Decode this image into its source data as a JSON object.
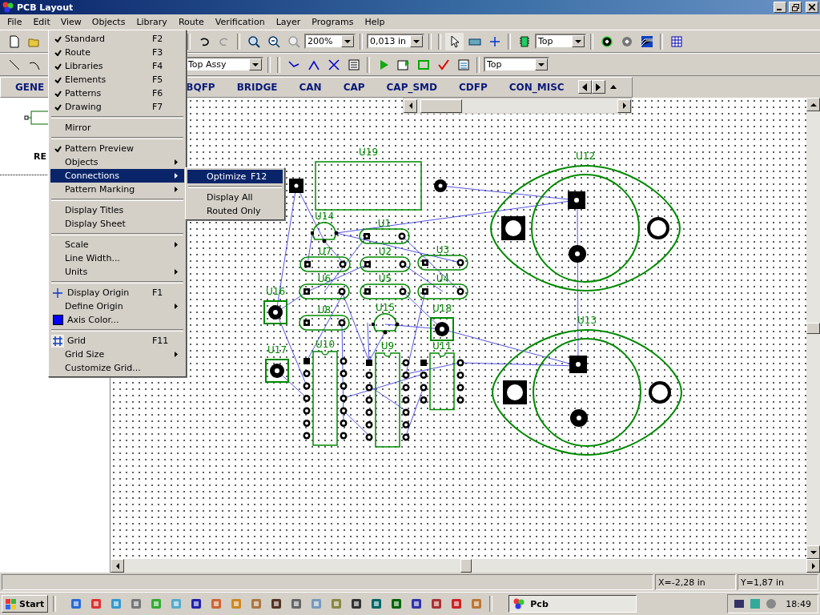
{
  "window": {
    "title": "PCB Layout"
  },
  "menu_bar": [
    {
      "label": "File",
      "selected": false
    },
    {
      "label": "Edit",
      "selected": false
    },
    {
      "label": "View",
      "selected": true
    },
    {
      "label": "Objects",
      "selected": false
    },
    {
      "label": "Library",
      "selected": false
    },
    {
      "label": "Route",
      "selected": false
    },
    {
      "label": "Verification",
      "selected": false
    },
    {
      "label": "Layer",
      "selected": false
    },
    {
      "label": "Programs",
      "selected": false
    },
    {
      "label": "Help",
      "selected": false
    }
  ],
  "toolbar_1": {
    "zoom": "200%",
    "line_width": "0,013 in",
    "layer": "Top"
  },
  "toolbar_2": {
    "assembly_layer": "Top Assy",
    "layer": "Top"
  },
  "library_tabs": [
    "GENE",
    "BQFP",
    "BRIDGE",
    "CAN",
    "CAP",
    "CAP_SMD",
    "CDFP",
    "CON_MISC"
  ],
  "pattern_preview": {
    "label": "RE"
  },
  "view_menu": [
    {
      "kind": "item",
      "label": "Standard",
      "shortcut": "F2",
      "checked": true,
      "selected": false,
      "submenu": false
    },
    {
      "kind": "item",
      "label": "Route",
      "shortcut": "F3",
      "checked": true,
      "selected": false,
      "submenu": false
    },
    {
      "kind": "item",
      "label": "Libraries",
      "shortcut": "F4",
      "checked": true,
      "selected": false,
      "submenu": false
    },
    {
      "kind": "item",
      "label": "Elements",
      "shortcut": "F5",
      "checked": true,
      "selected": false,
      "submenu": false
    },
    {
      "kind": "item",
      "label": "Patterns",
      "shortcut": "F6",
      "checked": true,
      "selected": false,
      "submenu": false
    },
    {
      "kind": "item",
      "label": "Drawing",
      "shortcut": "F7",
      "checked": true,
      "selected": false,
      "submenu": false
    },
    {
      "kind": "separator"
    },
    {
      "kind": "item",
      "label": "Mirror",
      "checked": false,
      "selected": false,
      "submenu": false
    },
    {
      "kind": "separator"
    },
    {
      "kind": "item",
      "label": "Pattern Preview",
      "checked": true,
      "selected": false,
      "submenu": false
    },
    {
      "kind": "item",
      "label": "Objects",
      "checked": false,
      "selected": false,
      "submenu": true
    },
    {
      "kind": "item",
      "label": "Connections",
      "checked": false,
      "selected": true,
      "submenu": true
    },
    {
      "kind": "item",
      "label": "Pattern Marking",
      "checked": false,
      "selected": false,
      "submenu": true
    },
    {
      "kind": "separator"
    },
    {
      "kind": "item",
      "label": "Display Titles",
      "checked": false,
      "selected": false,
      "submenu": false
    },
    {
      "kind": "item",
      "label": "Display Sheet",
      "checked": false,
      "selected": false,
      "submenu": false
    },
    {
      "kind": "separator"
    },
    {
      "kind": "item",
      "label": "Scale",
      "checked": false,
      "selected": false,
      "submenu": true
    },
    {
      "kind": "item",
      "label": "Line Width...",
      "checked": false,
      "selected": false,
      "submenu": false
    },
    {
      "kind": "item",
      "label": "Units",
      "checked": false,
      "selected": false,
      "submenu": true
    },
    {
      "kind": "separator"
    },
    {
      "kind": "item",
      "label": "Display Origin",
      "shortcut": "F1",
      "checked": false,
      "selected": false,
      "submenu": false
    },
    {
      "kind": "item",
      "label": "Define Origin",
      "checked": false,
      "selected": false,
      "submenu": true
    },
    {
      "kind": "item",
      "label": "Axis Color...",
      "checked": false,
      "selected": false,
      "submenu": false
    },
    {
      "kind": "separator"
    },
    {
      "kind": "item",
      "label": "Grid",
      "shortcut": "F11",
      "checked": true,
      "selected": false,
      "submenu": false
    },
    {
      "kind": "item",
      "label": "Grid Size",
      "checked": false,
      "selected": false,
      "submenu": true
    },
    {
      "kind": "item",
      "label": "Customize Grid...",
      "checked": false,
      "selected": false,
      "submenu": false
    }
  ],
  "connections_submenu": [
    {
      "kind": "item",
      "label": "Optimize",
      "shortcut": "F12",
      "selected": true
    },
    {
      "kind": "separator"
    },
    {
      "kind": "item",
      "label": "Display All",
      "selected": false
    },
    {
      "kind": "item",
      "label": "Routed Only",
      "selected": false
    }
  ],
  "board": {
    "components": [
      {
        "ref": "U19",
        "kind": "box"
      },
      {
        "ref": "U12",
        "kind": "to3"
      },
      {
        "ref": "U14",
        "kind": "to92"
      },
      {
        "ref": "U1",
        "kind": "two_pin"
      },
      {
        "ref": "U7",
        "kind": "two_pin"
      },
      {
        "ref": "U2",
        "kind": "two_pin"
      },
      {
        "ref": "U3",
        "kind": "two_pin"
      },
      {
        "ref": "U6",
        "kind": "two_pin"
      },
      {
        "ref": "U5",
        "kind": "two_pin"
      },
      {
        "ref": "U4",
        "kind": "two_pin"
      },
      {
        "ref": "U16",
        "kind": "pad"
      },
      {
        "ref": "U8",
        "kind": "two_pin"
      },
      {
        "ref": "U15",
        "kind": "to92"
      },
      {
        "ref": "U18",
        "kind": "pad"
      },
      {
        "ref": "U13",
        "kind": "to3"
      },
      {
        "ref": "U17",
        "kind": "pad"
      },
      {
        "ref": "U10",
        "kind": "dip"
      },
      {
        "ref": "U9",
        "kind": "dip"
      },
      {
        "ref": "U11",
        "kind": "dip"
      }
    ]
  },
  "status_bar": {
    "x": "X=-2,28 in",
    "y": "Y=1,87 in"
  },
  "taskbar": {
    "start": "Start",
    "task": "Pcb",
    "clock": "18:49"
  }
}
